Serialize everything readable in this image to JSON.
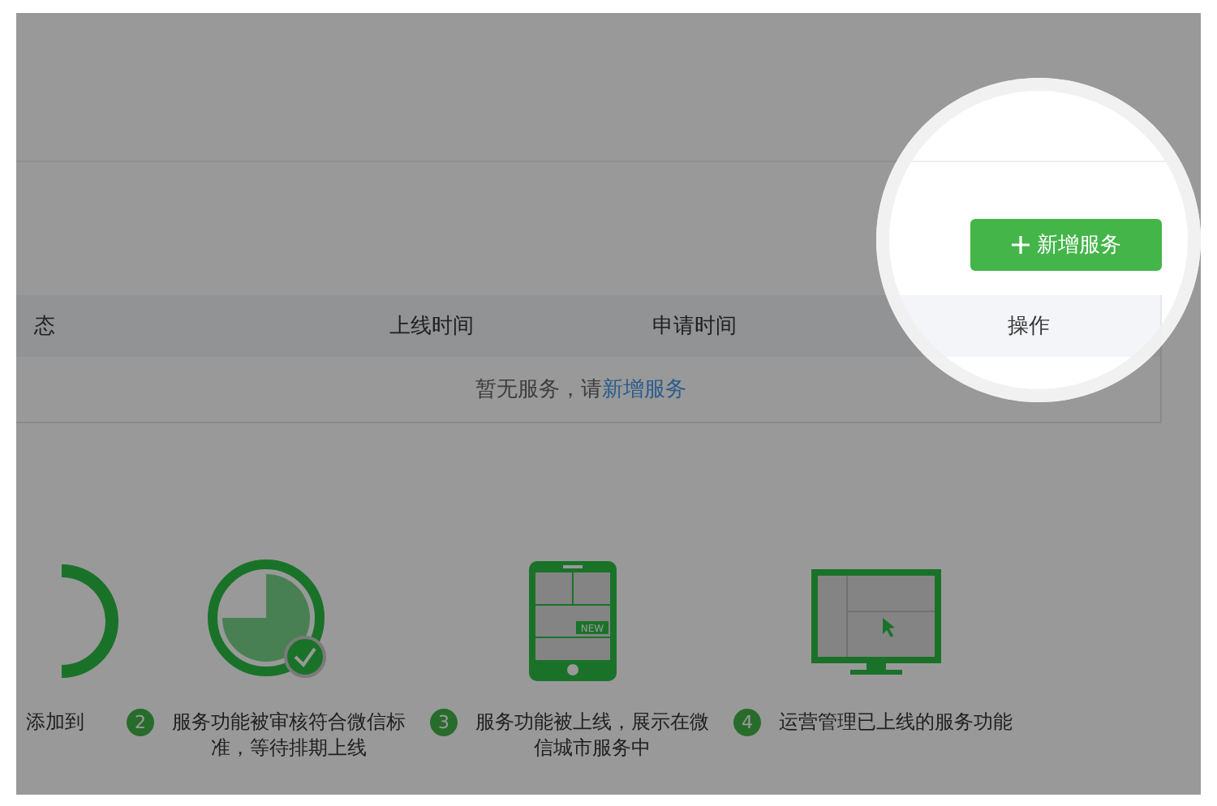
{
  "add_button": {
    "label": "新增服务"
  },
  "table": {
    "columns": [
      "态",
      "上线时间",
      "申请时间",
      "操作"
    ],
    "empty_text": "暂无服务，请",
    "empty_link": "新增服务"
  },
  "steps": [
    {
      "kind": "partial",
      "text": "添加到"
    },
    {
      "kind": "clock",
      "number": "2",
      "text": "服务功能被审核符合微信标准，等待排期上线"
    },
    {
      "kind": "phone",
      "number": "3",
      "badge": "NEW",
      "text": "服务功能被上线，展示在微信城市服务中"
    },
    {
      "kind": "monitor",
      "number": "4",
      "text": "运营管理已上线的服务功能"
    }
  ]
}
